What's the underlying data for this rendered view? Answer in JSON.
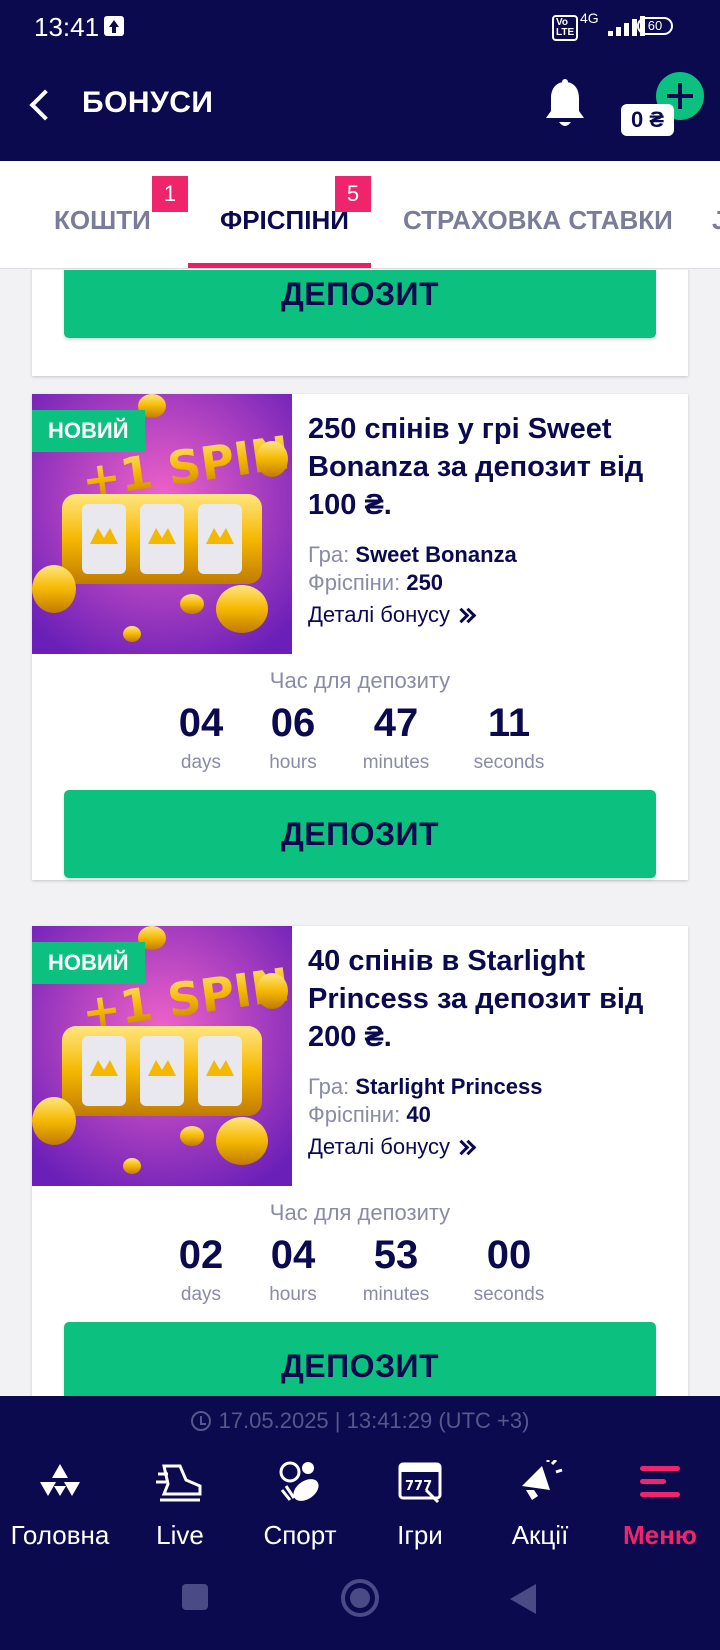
{
  "status_bar": {
    "time": "13:41",
    "volte": "Vo LTE",
    "network": "4G",
    "battery": "60"
  },
  "header": {
    "title": "БОНУСИ",
    "balance": "0 ₴"
  },
  "tabs": [
    {
      "label": "КОШТИ",
      "badge": "1"
    },
    {
      "label": "ФРІСПІНИ",
      "badge": "5"
    },
    {
      "label": "СТРАХОВКА СТАВКИ"
    }
  ],
  "top_card": {
    "button_label": "ДЕПОЗИТ"
  },
  "offers": [
    {
      "badge": "НОВИЙ",
      "image_text": "+1 SPIN",
      "title": "250 спінів у грі Sweet Bonanza за депозит від 100 ₴.",
      "game_label": "Гра:",
      "game_value": "Sweet Bonanza",
      "freespins_label": "Фріспіни:",
      "freespins_value": "250",
      "details_label": "Деталі бонусу",
      "timer_label": "Час для депозиту",
      "timer": {
        "days": "04",
        "hours": "06",
        "minutes": "47",
        "seconds": "11"
      },
      "timer_units": {
        "days": "days",
        "hours": "hours",
        "minutes": "minutes",
        "seconds": "seconds"
      },
      "button_label": "ДЕПОЗИТ"
    },
    {
      "badge": "НОВИЙ",
      "image_text": "+1 SPIN",
      "title": "40 спінів в Starlight Princess за депозит від 200 ₴.",
      "game_label": "Гра:",
      "game_value": "Starlight Princess",
      "freespins_label": "Фріспіни:",
      "freespins_value": "40",
      "details_label": "Деталі бонусу",
      "timer_label": "Час для депозиту",
      "timer": {
        "days": "02",
        "hours": "04",
        "minutes": "53",
        "seconds": "00"
      },
      "timer_units": {
        "days": "days",
        "hours": "hours",
        "minutes": "minutes",
        "seconds": "seconds"
      },
      "button_label": "ДЕПОЗИТ"
    }
  ],
  "footer": {
    "datetime": "17.05.2025 | 13:41:29 (UTC +3)",
    "nav": [
      {
        "label": "Головна",
        "icon": "home-logo-icon"
      },
      {
        "label": "Live",
        "icon": "running-shoe-icon"
      },
      {
        "label": "Спорт",
        "icon": "sport-balls-icon"
      },
      {
        "label": "Ігри",
        "icon": "slot-machine-icon"
      },
      {
        "label": "Акції",
        "icon": "megaphone-icon"
      },
      {
        "label": "Меню",
        "icon": "menu-icon",
        "active": true
      }
    ]
  },
  "colors": {
    "navy": "#0b0a4f",
    "green": "#0cc07f",
    "pink": "#f0246a"
  }
}
